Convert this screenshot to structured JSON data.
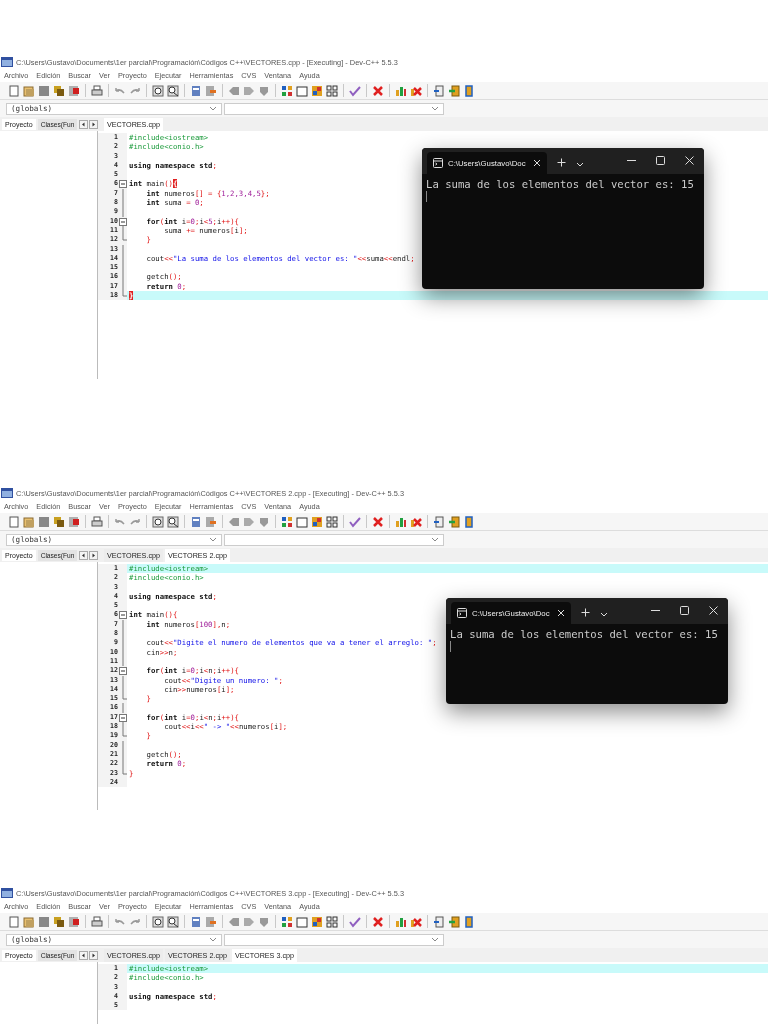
{
  "screenshots": [
    {
      "title": "C:\\Users\\Gustavo\\Documents\\1er parcial\\Programación\\Códigos C++\\VECTORES.cpp - [Executing] - Dev-C++ 5.5.3",
      "menu": [
        "Archivo",
        "Edición",
        "Buscar",
        "Ver",
        "Proyecto",
        "Ejecutar",
        "Herramientas",
        "CVS",
        "Ventana",
        "Ayuda"
      ],
      "scope_combo": "(globals)",
      "side_tabs": [
        {
          "label": "Proyecto",
          "selected": true
        },
        {
          "label": "Clases(Fun",
          "selected": false
        }
      ],
      "file_tabs": [
        {
          "label": "VECTORES.cpp",
          "selected": true
        }
      ],
      "code_lines": [
        {
          "number": "1",
          "kind": "plain",
          "current": false,
          "tokens": [
            {
              "kind": "pre",
              "text": "#include<iostream>"
            }
          ]
        },
        {
          "number": "2",
          "kind": "plain",
          "current": false,
          "tokens": [
            {
              "kind": "pre",
              "text": "#include<conio.h>"
            }
          ]
        },
        {
          "number": "3",
          "kind": "plain",
          "current": false
        },
        {
          "number": "4",
          "kind": "plain",
          "current": false,
          "tokens": [
            {
              "kind": "kw",
              "text": "using namespace std"
            },
            {
              "kind": "sym",
              "text": ";"
            }
          ]
        },
        {
          "number": "5",
          "kind": "plain",
          "current": false
        },
        {
          "number": "6",
          "kind": "fold_start",
          "current": false,
          "tokens": [
            {
              "kind": "kw",
              "text": "int"
            },
            {
              "kind": "id",
              "text": " main"
            },
            {
              "kind": "sym",
              "text": "()"
            },
            {
              "kind": "match",
              "text": "{"
            }
          ]
        },
        {
          "number": "7",
          "kind": "fold_body",
          "current": false,
          "tokens": [
            {
              "kind": "kw",
              "text": "    int"
            },
            {
              "kind": "id",
              "text": " numeros"
            },
            {
              "kind": "sym",
              "text": "[] = {"
            },
            {
              "kind": "num",
              "text": "1,2,3,4,5"
            },
            {
              "kind": "sym",
              "text": "};"
            }
          ]
        },
        {
          "number": "8",
          "kind": "fold_body",
          "current": false,
          "tokens": [
            {
              "kind": "kw",
              "text": "    int"
            },
            {
              "kind": "id",
              "text": " suma "
            },
            {
              "kind": "sym",
              "text": "= "
            },
            {
              "kind": "num",
              "text": "0"
            },
            {
              "kind": "sym",
              "text": ";"
            }
          ]
        },
        {
          "number": "9",
          "kind": "fold_body",
          "current": false
        },
        {
          "number": "10",
          "kind": "fold_start",
          "current": false,
          "tokens": [
            {
              "kind": "kw",
              "text": "    for"
            },
            {
              "kind": "sym",
              "text": "("
            },
            {
              "kind": "kw",
              "text": "int"
            },
            {
              "kind": "id",
              "text": " i"
            },
            {
              "kind": "sym",
              "text": "="
            },
            {
              "kind": "num",
              "text": "0"
            },
            {
              "kind": "sym",
              "text": ";"
            },
            {
              "kind": "id",
              "text": "i"
            },
            {
              "kind": "sym",
              "text": "<"
            },
            {
              "kind": "num",
              "text": "5"
            },
            {
              "kind": "sym",
              "text": ";"
            },
            {
              "kind": "id",
              "text": "i"
            },
            {
              "kind": "sym",
              "text": "++){"
            }
          ]
        },
        {
          "number": "11",
          "kind": "fold_body",
          "current": false,
          "tokens": [
            {
              "kind": "id",
              "text": "        suma "
            },
            {
              "kind": "sym",
              "text": "+= "
            },
            {
              "kind": "id",
              "text": "numeros"
            },
            {
              "kind": "sym",
              "text": "["
            },
            {
              "kind": "id",
              "text": "i"
            },
            {
              "kind": "sym",
              "text": "];"
            }
          ]
        },
        {
          "number": "12",
          "kind": "fold_end",
          "current": false,
          "tokens": [
            {
              "kind": "sym",
              "text": "    }"
            }
          ]
        },
        {
          "number": "13",
          "kind": "fold_body",
          "current": false
        },
        {
          "number": "14",
          "kind": "fold_body",
          "current": false,
          "tokens": [
            {
              "kind": "id",
              "text": "    cout"
            },
            {
              "kind": "sym",
              "text": "<<"
            },
            {
              "kind": "str",
              "text": "\"La suma de los elementos del vector es: \""
            },
            {
              "kind": "sym",
              "text": "<<"
            },
            {
              "kind": "id",
              "text": "suma"
            },
            {
              "kind": "sym",
              "text": "<<"
            },
            {
              "kind": "id",
              "text": "endl"
            },
            {
              "kind": "sym",
              "text": ";"
            }
          ]
        },
        {
          "number": "15",
          "kind": "fold_body",
          "current": false
        },
        {
          "number": "16",
          "kind": "fold_body",
          "current": false,
          "tokens": [
            {
              "kind": "id",
              "text": "    getch"
            },
            {
              "kind": "sym",
              "text": "();"
            }
          ]
        },
        {
          "number": "17",
          "kind": "fold_body",
          "current": false,
          "tokens": [
            {
              "kind": "kw",
              "text": "    return "
            },
            {
              "kind": "num",
              "text": "0"
            },
            {
              "kind": "sym",
              "text": ";"
            }
          ]
        },
        {
          "number": "18",
          "kind": "fold_end",
          "current": true,
          "tokens": [
            {
              "kind": "match",
              "text": "}"
            }
          ]
        }
      ],
      "console": {
        "tab_title": "C:\\Users\\Gustavo\\Doc",
        "output": "La suma de los elementos del vector es: 15"
      }
    },
    {
      "title": "C:\\Users\\Gustavo\\Documents\\1er parcial\\Programación\\Códigos C++\\VECTORES 2.cpp - [Executing] - Dev-C++ 5.5.3",
      "menu": [
        "Archivo",
        "Edición",
        "Buscar",
        "Ver",
        "Proyecto",
        "Ejecutar",
        "Herramientas",
        "CVS",
        "Ventana",
        "Ayuda"
      ],
      "scope_combo": "(globals)",
      "side_tabs": [
        {
          "label": "Proyecto",
          "selected": true
        },
        {
          "label": "Clases(Fun",
          "selected": false
        }
      ],
      "file_tabs": [
        {
          "label": "VECTORES.cpp",
          "selected": false
        },
        {
          "label": "VECTORES 2.cpp",
          "selected": true
        }
      ],
      "code_lines": [
        {
          "number": "1",
          "kind": "plain",
          "current": true,
          "tokens": [
            {
              "kind": "pre",
              "text": "#include<iostream>"
            }
          ]
        },
        {
          "number": "2",
          "kind": "plain",
          "current": false,
          "tokens": [
            {
              "kind": "pre",
              "text": "#include<conio.h>"
            }
          ]
        },
        {
          "number": "3",
          "kind": "plain",
          "current": false
        },
        {
          "number": "4",
          "kind": "plain",
          "current": false,
          "tokens": [
            {
              "kind": "kw",
              "text": "using namespace std"
            },
            {
              "kind": "sym",
              "text": ";"
            }
          ]
        },
        {
          "number": "5",
          "kind": "plain",
          "current": false
        },
        {
          "number": "6",
          "kind": "fold_start",
          "current": false,
          "tokens": [
            {
              "kind": "kw",
              "text": "int"
            },
            {
              "kind": "id",
              "text": " main"
            },
            {
              "kind": "sym",
              "text": "(){"
            }
          ]
        },
        {
          "number": "7",
          "kind": "fold_body",
          "current": false,
          "tokens": [
            {
              "kind": "kw",
              "text": "    int"
            },
            {
              "kind": "id",
              "text": " numeros"
            },
            {
              "kind": "sym",
              "text": "["
            },
            {
              "kind": "num",
              "text": "100"
            },
            {
              "kind": "sym",
              "text": "],"
            },
            {
              "kind": "id",
              "text": "n"
            },
            {
              "kind": "sym",
              "text": ";"
            }
          ]
        },
        {
          "number": "8",
          "kind": "fold_body",
          "current": false
        },
        {
          "number": "9",
          "kind": "fold_body",
          "current": false,
          "tokens": [
            {
              "kind": "id",
              "text": "    cout"
            },
            {
              "kind": "sym",
              "text": "<<"
            },
            {
              "kind": "str",
              "text": "\"Digite el numero de elementos que va a tener el arreglo: \""
            },
            {
              "kind": "sym",
              "text": ";"
            }
          ]
        },
        {
          "number": "10",
          "kind": "fold_body",
          "current": false,
          "tokens": [
            {
              "kind": "id",
              "text": "    cin"
            },
            {
              "kind": "sym",
              "text": ">>"
            },
            {
              "kind": "id",
              "text": "n"
            },
            {
              "kind": "sym",
              "text": ";"
            }
          ]
        },
        {
          "number": "11",
          "kind": "fold_body",
          "current": false
        },
        {
          "number": "12",
          "kind": "fold_start",
          "current": false,
          "tokens": [
            {
              "kind": "kw",
              "text": "    for"
            },
            {
              "kind": "sym",
              "text": "("
            },
            {
              "kind": "kw",
              "text": "int"
            },
            {
              "kind": "id",
              "text": " i"
            },
            {
              "kind": "sym",
              "text": "="
            },
            {
              "kind": "num",
              "text": "0"
            },
            {
              "kind": "sym",
              "text": ";"
            },
            {
              "kind": "id",
              "text": "i"
            },
            {
              "kind": "sym",
              "text": "<"
            },
            {
              "kind": "id",
              "text": "n"
            },
            {
              "kind": "sym",
              "text": ";"
            },
            {
              "kind": "id",
              "text": "i"
            },
            {
              "kind": "sym",
              "text": "++){"
            }
          ]
        },
        {
          "number": "13",
          "kind": "fold_body",
          "current": false,
          "tokens": [
            {
              "kind": "id",
              "text": "        cout"
            },
            {
              "kind": "sym",
              "text": "<<"
            },
            {
              "kind": "str",
              "text": "\"Digite un numero: \""
            },
            {
              "kind": "sym",
              "text": ";"
            }
          ]
        },
        {
          "number": "14",
          "kind": "fold_body",
          "current": false,
          "tokens": [
            {
              "kind": "id",
              "text": "        cin"
            },
            {
              "kind": "sym",
              "text": ">>"
            },
            {
              "kind": "id",
              "text": "numeros"
            },
            {
              "kind": "sym",
              "text": "["
            },
            {
              "kind": "id",
              "text": "i"
            },
            {
              "kind": "sym",
              "text": "];"
            }
          ]
        },
        {
          "number": "15",
          "kind": "fold_end",
          "current": false,
          "tokens": [
            {
              "kind": "sym",
              "text": "    }"
            }
          ]
        },
        {
          "number": "16",
          "kind": "fold_body",
          "current": false
        },
        {
          "number": "17",
          "kind": "fold_start",
          "current": false,
          "tokens": [
            {
              "kind": "kw",
              "text": "    for"
            },
            {
              "kind": "sym",
              "text": "("
            },
            {
              "kind": "kw",
              "text": "int"
            },
            {
              "kind": "id",
              "text": " i"
            },
            {
              "kind": "sym",
              "text": "="
            },
            {
              "kind": "num",
              "text": "0"
            },
            {
              "kind": "sym",
              "text": ";"
            },
            {
              "kind": "id",
              "text": "i"
            },
            {
              "kind": "sym",
              "text": "<"
            },
            {
              "kind": "id",
              "text": "n"
            },
            {
              "kind": "sym",
              "text": ";"
            },
            {
              "kind": "id",
              "text": "i"
            },
            {
              "kind": "sym",
              "text": "++){"
            }
          ]
        },
        {
          "number": "18",
          "kind": "fold_body",
          "current": false,
          "tokens": [
            {
              "kind": "id",
              "text": "        cout"
            },
            {
              "kind": "sym",
              "text": "<<"
            },
            {
              "kind": "id",
              "text": "i"
            },
            {
              "kind": "sym",
              "text": "<<"
            },
            {
              "kind": "str",
              "text": "\" -> \""
            },
            {
              "kind": "sym",
              "text": "<<"
            },
            {
              "kind": "id",
              "text": "numeros"
            },
            {
              "kind": "sym",
              "text": "["
            },
            {
              "kind": "id",
              "text": "i"
            },
            {
              "kind": "sym",
              "text": "];"
            }
          ]
        },
        {
          "number": "19",
          "kind": "fold_end",
          "current": false,
          "tokens": [
            {
              "kind": "sym",
              "text": "    }"
            }
          ]
        },
        {
          "number": "20",
          "kind": "fold_body",
          "current": false
        },
        {
          "number": "21",
          "kind": "fold_body",
          "current": false,
          "tokens": [
            {
              "kind": "id",
              "text": "    getch"
            },
            {
              "kind": "sym",
              "text": "();"
            }
          ]
        },
        {
          "number": "22",
          "kind": "fold_body",
          "current": false,
          "tokens": [
            {
              "kind": "kw",
              "text": "    return "
            },
            {
              "kind": "num",
              "text": "0"
            },
            {
              "kind": "sym",
              "text": ";"
            }
          ]
        },
        {
          "number": "23",
          "kind": "fold_end",
          "current": false,
          "tokens": [
            {
              "kind": "sym",
              "text": "}"
            }
          ]
        },
        {
          "number": "24",
          "kind": "plain",
          "current": false
        }
      ],
      "console": {
        "tab_title": "C:\\Users\\Gustavo\\Doc",
        "output": "La suma de los elementos del vector es: 15"
      }
    },
    {
      "title": "C:\\Users\\Gustavo\\Documents\\1er parcial\\Programación\\Códigos C++\\VECTORES 3.cpp - [Executing] - Dev-C++ 5.5.3",
      "menu": [
        "Archivo",
        "Edición",
        "Buscar",
        "Ver",
        "Proyecto",
        "Ejecutar",
        "Herramientas",
        "CVS",
        "Ventana",
        "Ayuda"
      ],
      "scope_combo": "(globals)",
      "side_tabs": [
        {
          "label": "Proyecto",
          "selected": true
        },
        {
          "label": "Clases(Fun",
          "selected": false
        }
      ],
      "file_tabs": [
        {
          "label": "VECTORES.cpp",
          "selected": false
        },
        {
          "label": "VECTORES 2.cpp",
          "selected": false
        },
        {
          "label": "VECTORES 3.cpp",
          "selected": true
        }
      ],
      "code_lines": [
        {
          "number": "1",
          "kind": "plain",
          "current": true,
          "tokens": [
            {
              "kind": "pre",
              "text": "#include<iostream>"
            }
          ]
        },
        {
          "number": "2",
          "kind": "plain",
          "current": false,
          "tokens": [
            {
              "kind": "pre",
              "text": "#include<conio.h>"
            }
          ]
        },
        {
          "number": "3",
          "kind": "plain",
          "current": false
        },
        {
          "number": "4",
          "kind": "plain",
          "current": false,
          "tokens": [
            {
              "kind": "kw",
              "text": "using namespace std"
            },
            {
              "kind": "sym",
              "text": ";"
            }
          ]
        },
        {
          "number": "5",
          "kind": "plain",
          "current": false
        }
      ]
    }
  ]
}
